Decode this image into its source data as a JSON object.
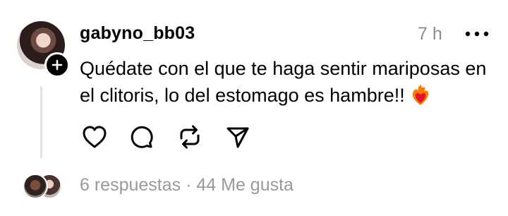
{
  "post": {
    "username": "gabyno_bb03",
    "time": "7 h",
    "text": "Quédate con el que te haga sentir mariposas en el clitoris, lo del estomago es hambre!!",
    "emoji_icon": "heart-on-fire-icon",
    "replies": "6 respuestas",
    "separator": "·",
    "likes": "44 Me gusta"
  },
  "icons": {
    "more": "more-horizontal-icon",
    "follow": "plus-icon",
    "like": "heart-icon",
    "comment": "comment-icon",
    "repost": "repost-icon",
    "share": "send-icon"
  },
  "colors": {
    "text": "#000000",
    "muted": "#999999",
    "line": "#e2e2e2"
  }
}
